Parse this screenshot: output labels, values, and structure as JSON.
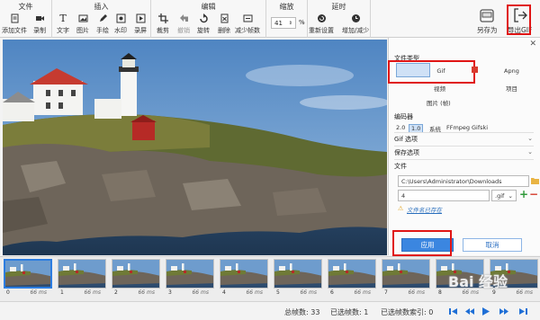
{
  "ribbon": {
    "groups": {
      "file": "文件",
      "insert": "插入",
      "edit": "编辑",
      "zoom": "缩放",
      "delay": "延时"
    },
    "file_tools": {
      "add_file": "添加文件",
      "record": "录制"
    },
    "insert_tools": {
      "text": "文字",
      "image": "图片",
      "draw": "手绘",
      "watermark": "水印",
      "screen_record": "录屏"
    },
    "edit_tools": {
      "crop": "裁剪",
      "undo": "撤销",
      "rotate": "旋转",
      "delete": "删除",
      "reduce_frames": "减少帧数"
    },
    "zoom": {
      "value": "41",
      "unit": "%"
    },
    "delay_tools": {
      "reset": "重新设置",
      "add_reduce": "增加/减少"
    },
    "save_as": "另存为",
    "export_gif": "导出GIF"
  },
  "panel": {
    "file_type_label": "文件类型",
    "formats": {
      "gif": "Gif",
      "apng": "Apng",
      "video": "视频",
      "project": "项目",
      "images": "图片 (帧)"
    },
    "encoder_label": "编码器",
    "encoders": [
      "2.0",
      "1.0",
      "系统",
      "FFmpeg",
      "Gifski"
    ],
    "gif_options": "Gif 选项",
    "save_options": "保存选项",
    "file_label": "文件",
    "folder_path": "C:\\Users\\Administrator\\Downloads",
    "file_name": "4",
    "extension": ".gif",
    "filename_link": "文件名已存在",
    "apply": "应用",
    "cancel": "取消"
  },
  "filmstrip": {
    "frames": [
      {
        "index": "0",
        "ms": "66 ms"
      },
      {
        "index": "1",
        "ms": "66 ms"
      },
      {
        "index": "2",
        "ms": "66 ms"
      },
      {
        "index": "3",
        "ms": "66 ms"
      },
      {
        "index": "4",
        "ms": "66 ms"
      },
      {
        "index": "5",
        "ms": "66 ms"
      },
      {
        "index": "6",
        "ms": "66 ms"
      },
      {
        "index": "7",
        "ms": "66 ms"
      },
      {
        "index": "8",
        "ms": "66 ms"
      },
      {
        "index": "9",
        "ms": "66 ms"
      }
    ]
  },
  "status": {
    "total_frames": "总帧数: 33",
    "selected_count": "已选帧数: 1",
    "selected_index": "已选帧数索引: 0"
  },
  "watermark": "Bai 经验",
  "colors": {
    "accent": "#3b86e0",
    "highlight": "#e01515",
    "selection": "#2d7de0"
  }
}
